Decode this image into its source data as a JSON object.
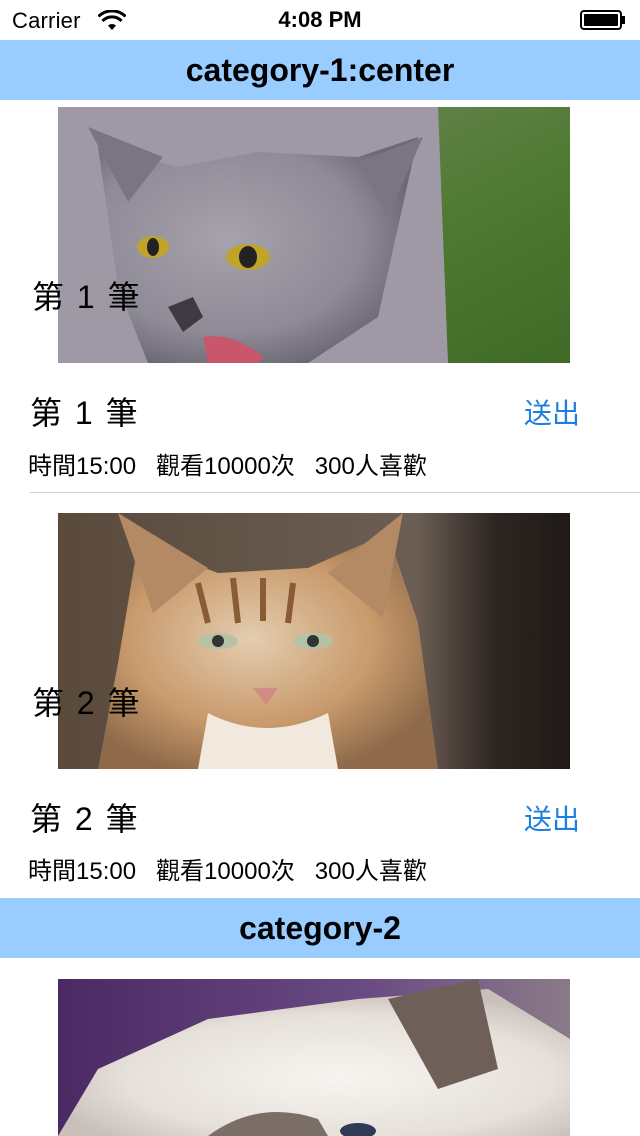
{
  "status_bar": {
    "carrier": "Carrier",
    "time": "4:08 PM"
  },
  "sections": [
    {
      "title": "category-1:center",
      "items": [
        {
          "overlay_label": "第 1 筆",
          "title": "第 1 筆",
          "action": "送出",
          "meta": "時間15:00   觀看10000次   300人喜歡"
        },
        {
          "overlay_label": "第 2 筆",
          "title": "第 2 筆",
          "action": "送出",
          "meta": "時間15:00   觀看10000次   300人喜歡"
        }
      ]
    },
    {
      "title": "category-2",
      "items": []
    }
  ],
  "colors": {
    "section_header_bg": "#99ccff",
    "action_blue": "#1f7fe0"
  }
}
